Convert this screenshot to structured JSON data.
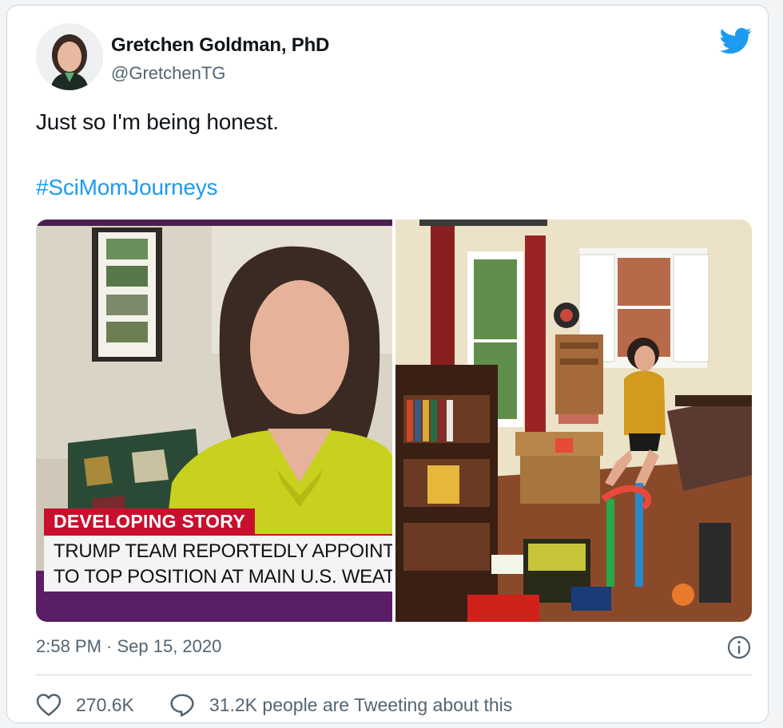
{
  "tweet": {
    "author_name": "Gretchen Goldman, PhD",
    "handle": "@GretchenTG",
    "text": "Just so I'm being honest.",
    "hashtag": "#SciMomJourneys",
    "timestamp": "2:58 PM · Sep 15, 2020"
  },
  "media": {
    "left": {
      "chyron_tag": "DEVELOPING STORY",
      "chyron_line1": "TRUMP TEAM REPORTEDLY APPOINTS C",
      "chyron_line2": "TO TOP POSITION AT MAIN U.S. WEATHI"
    }
  },
  "actions": {
    "likes": "270.6K",
    "conversation": "31.2K people are Tweeting about this"
  },
  "colors": {
    "accent": "#1d9bf0",
    "text_primary": "#0f1419",
    "text_secondary": "#536471",
    "border": "#cfd9de",
    "cnn_red": "#c8102e"
  },
  "icons": {
    "brand": "twitter-bird-icon",
    "info": "info-icon",
    "like": "heart-icon",
    "reply": "speech-bubble-icon"
  }
}
